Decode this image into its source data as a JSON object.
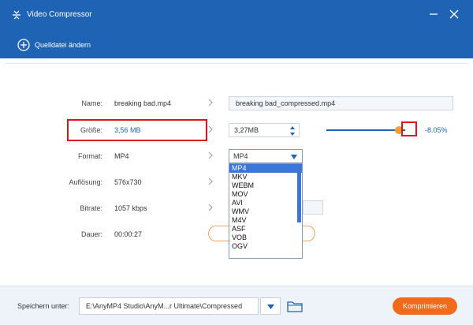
{
  "window": {
    "title": "Video Compressor",
    "icon": "compress-icon"
  },
  "toolbar": {
    "change_source_label": "Quelldatei ändern",
    "icon": "plus-circle-icon"
  },
  "form": {
    "name": {
      "label": "Name:",
      "source": "breaking bad.mp4",
      "output": "breaking bad_compressed.mp4"
    },
    "size": {
      "label": "Größe:",
      "source": "3,56 MB",
      "output": "3,27MB",
      "percent": "-8.05%",
      "slider_fraction": 0.92
    },
    "format": {
      "label": "Format:",
      "source": "MP4",
      "selected": "MP4",
      "options": [
        "MP4",
        "MKV",
        "WEBM",
        "MOV",
        "AVI",
        "WMV",
        "M4V",
        "ASF",
        "VOB",
        "OGV"
      ]
    },
    "resolution": {
      "label": "Auflösung:",
      "source": "576x730"
    },
    "bitrate": {
      "label": "Bitrate:",
      "source": "1057 kbps"
    },
    "duration": {
      "label": "Dauer:",
      "source": "00:00:27"
    }
  },
  "footer": {
    "save_label": "Speichern unter:",
    "path": "E:\\AnyMP4 Studio\\AnyM...r Ultimate\\Compressed",
    "compress_label": "Komprimieren"
  },
  "colors": {
    "brand": "#1f63b5",
    "accent": "#f26a1b",
    "highlight": "#e0121c",
    "selection": "#3a77d6"
  }
}
